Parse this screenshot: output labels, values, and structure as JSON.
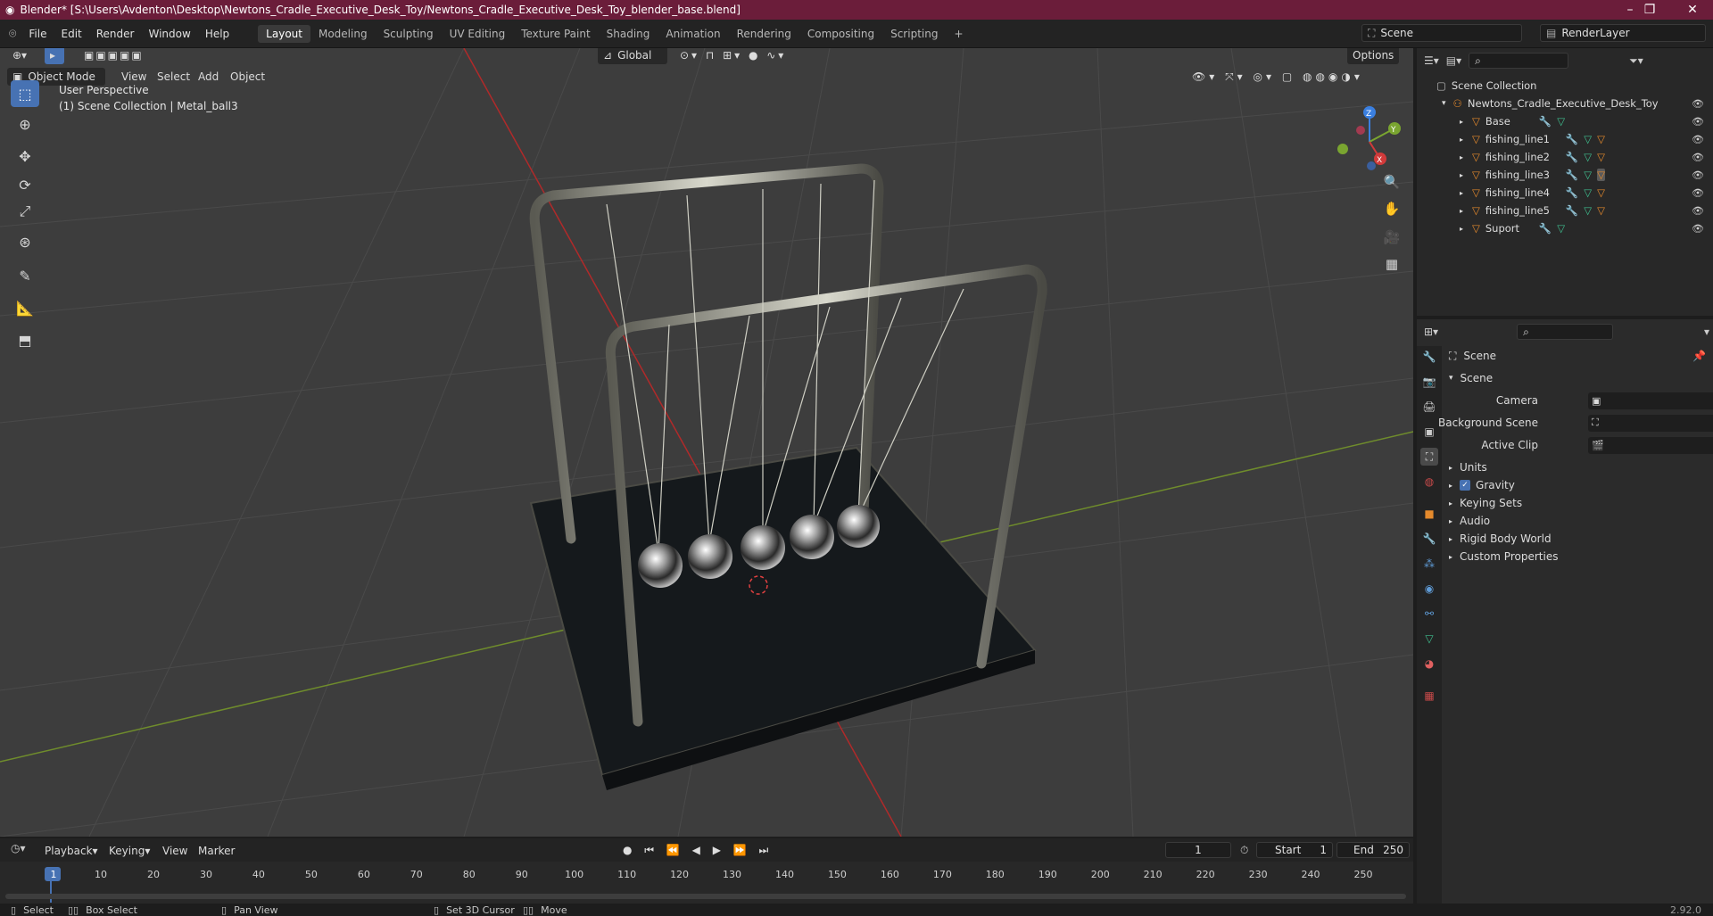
{
  "window": {
    "title": "Blender* [S:\\Users\\Avdenton\\Desktop\\Newtons_Cradle_Executive_Desk_Toy/Newtons_Cradle_Executive_Desk_Toy_blender_base.blend]",
    "minimize": "–",
    "maximize": "❐",
    "close": "✕"
  },
  "menubar": {
    "items": [
      "File",
      "Edit",
      "Render",
      "Window",
      "Help"
    ],
    "workspaces": [
      "Layout",
      "Modeling",
      "Sculpting",
      "UV Editing",
      "Texture Paint",
      "Shading",
      "Animation",
      "Rendering",
      "Compositing",
      "Scripting"
    ],
    "active_workspace": "Layout",
    "add_workspace": "+",
    "scene": "Scene",
    "render_layer": "RenderLayer"
  },
  "viewport": {
    "mode": "Object Mode",
    "menus": [
      "View",
      "Select",
      "Add",
      "Object"
    ],
    "orientation": "Global",
    "options": "Options",
    "info_line1": "User Perspective",
    "info_line2": "(1) Scene Collection | Metal_ball3",
    "gizmo": {
      "z": "Z",
      "y": "Y",
      "x": "X"
    }
  },
  "outliner": {
    "root": "Scene Collection",
    "collection": "Newtons_Cradle_Executive_Desk_Toy",
    "objects": [
      "Base",
      "fishing_line1",
      "fishing_line2",
      "fishing_line3",
      "fishing_line4",
      "fishing_line5",
      "Suport"
    ]
  },
  "properties": {
    "context": "Scene",
    "panel": "Scene",
    "camera_label": "Camera",
    "background_label": "Background Scene",
    "clip_label": "Active Clip",
    "sections": [
      "Units",
      "Gravity",
      "Keying Sets",
      "Audio",
      "Rigid Body World",
      "Custom Properties"
    ],
    "gravity_checked": true
  },
  "timeline": {
    "menus": [
      "Playback",
      "Keying",
      "View",
      "Marker"
    ],
    "current_frame": "1",
    "start_label": "Start",
    "start": "1",
    "end_label": "End",
    "end": "250",
    "ticks": [
      "1",
      "10",
      "20",
      "30",
      "40",
      "50",
      "60",
      "70",
      "80",
      "90",
      "100",
      "110",
      "120",
      "130",
      "140",
      "150",
      "160",
      "170",
      "180",
      "190",
      "200",
      "210",
      "220",
      "230",
      "240",
      "250"
    ]
  },
  "statusbar": {
    "select": "Select",
    "box_select": "Box Select",
    "pan_view": "Pan View",
    "set_cursor": "Set 3D Cursor",
    "move": "Move",
    "version": "2.92.0"
  },
  "colors": {
    "title_bar": "#6b1d3a",
    "accent": "#4772b3",
    "object_icon": "#e58a2c",
    "modifier_icon": "#5f9bd6",
    "mesh_icon": "#3fbf8f"
  }
}
